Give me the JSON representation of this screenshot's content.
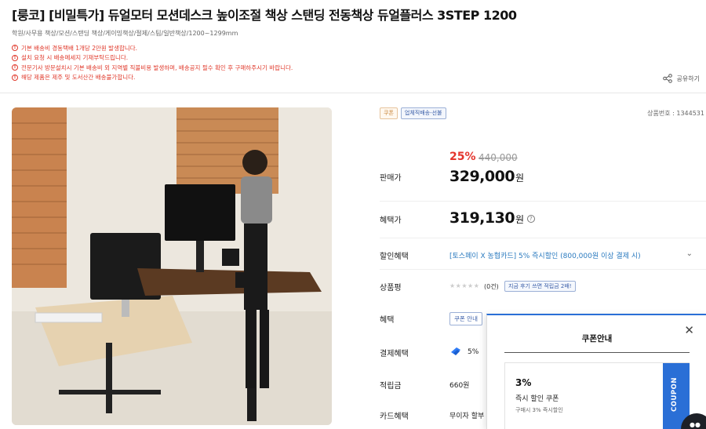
{
  "product": {
    "title": "[룽코] [비밀특가] 듀얼모터 모션데스크 높이조절 책상 스탠딩 전동책상 듀얼플러스 3STEP 1200",
    "categories": "학원/사무용 책상/모션/스탠딩 책상/게이밍책상/절제/스팀/일반책상/1200~1299mm"
  },
  "notices": [
    "기본 배송비 경동택배 1개당 2만원 발생합니다.",
    "설치 요청 시 배송메세지 기재부탁드립니다.",
    "전문기사 방문설치시 기본 배송비 외 지역별 직불비용 발생하며, 배송공지 필수 확인 후 구매하주시기 바랍니다.",
    "해당 제품은 제주 및 도서산간 배송불가합니다."
  ],
  "share": {
    "label": "공유하기",
    "icon": "share-icon"
  },
  "badges": {
    "coupon": "쿠폰",
    "shipping": "업체직배송-선불"
  },
  "product_code": "상품번호 : 1344531",
  "price": {
    "discount": "25%",
    "original": "440,000",
    "sale_label": "판매가",
    "sale_value": "329,000",
    "won": "원",
    "benefit_label": "혜택가",
    "benefit_value": "319,130"
  },
  "discount_benefit": {
    "label": "할인혜택",
    "value": "[토스페이 X 농협카드] 5% 즉시할인 (800,000원 이상 결제 시)"
  },
  "review": {
    "label": "상품평",
    "stars": "★★★★★",
    "count": "(0건)",
    "tip": "지금 후기 쓰면 적립금 2배!"
  },
  "benefit": {
    "label": "혜택",
    "coupon_button": "쿠폰 안내"
  },
  "payment": {
    "label": "결제혜택",
    "percent": "5%"
  },
  "points": {
    "label": "적립금",
    "value": "660원"
  },
  "card": {
    "label": "카드혜택",
    "value": "무이자 할부"
  },
  "coupon_popup": {
    "title": "쿠폰안내",
    "close": "✕",
    "coupon_percent": "3%",
    "coupon_name": "즉시 할인 쿠폰",
    "coupon_desc": "구매시 3% 즉시할인",
    "tab_label": "COUPON"
  },
  "colors": {
    "accent": "#2a6fd6",
    "sale_red": "#e4342c",
    "notice_red": "#e0392b"
  }
}
